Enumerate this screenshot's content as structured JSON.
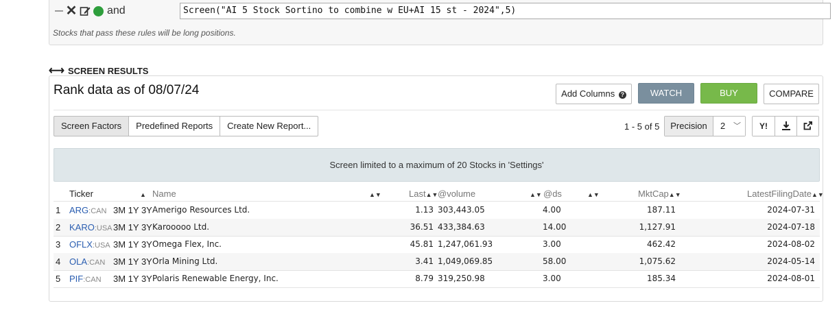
{
  "rule": {
    "connector": "and",
    "formula": "Screen(\"AI 5 Stock Sortino to combine w EU+AI 15 st - 2024\",5)",
    "note": "Stocks that pass these rules will be long positions."
  },
  "section_title": "SCREEN RESULTS",
  "rank_title": "Rank data as of 08/07/24",
  "buttons": {
    "add_columns": "Add Columns",
    "watch": "WATCH",
    "buy": "BUY",
    "compare": "COMPARE"
  },
  "tabs": [
    "Screen Factors",
    "Predefined Reports",
    "Create New Report..."
  ],
  "pagination": "1 - 5 of 5",
  "precision": {
    "label": "Precision",
    "value": "2"
  },
  "tools": {
    "yahoo": "Y!"
  },
  "notice": "Screen limited to a maximum of 20 Stocks in 'Settings'",
  "columns": {
    "ticker": "Ticker",
    "name": "Name",
    "last": "Last",
    "volume": "@volume",
    "ds": "@ds",
    "mktcap": "MktCap",
    "filing": "LatestFilingDate"
  },
  "period_labels": "3M 1Y 3Y",
  "rows": [
    {
      "idx": "1",
      "ticker": "ARG",
      "exchange": ":CAN",
      "name": "Amerigo Resources Ltd.",
      "last": "1.13",
      "volume": "303,443.05",
      "ds": "4.00",
      "mktcap": "187.11",
      "filing": "2024-07-31"
    },
    {
      "idx": "2",
      "ticker": "KARO",
      "exchange": ":USA",
      "name": "Karooooo Ltd.",
      "last": "36.51",
      "volume": "433,384.63",
      "ds": "14.00",
      "mktcap": "1,127.91",
      "filing": "2024-07-18"
    },
    {
      "idx": "3",
      "ticker": "OFLX",
      "exchange": ":USA",
      "name": "Omega Flex, Inc.",
      "last": "45.81",
      "volume": "1,247,061.93",
      "ds": "3.00",
      "mktcap": "462.42",
      "filing": "2024-08-02"
    },
    {
      "idx": "4",
      "ticker": "OLA",
      "exchange": ":CAN",
      "name": "Orla Mining Ltd.",
      "last": "3.41",
      "volume": "1,049,069.85",
      "ds": "58.00",
      "mktcap": "1,075.62",
      "filing": "2024-05-14"
    },
    {
      "idx": "5",
      "ticker": "PIF",
      "exchange": ":CAN",
      "name": "Polaris Renewable Energy, Inc.",
      "last": "8.79",
      "volume": "319,250.98",
      "ds": "3.00",
      "mktcap": "185.34",
      "filing": "2024-08-01"
    }
  ],
  "colors": {
    "watch": "#7a8f9e",
    "buy": "#77b94a",
    "active_dot": "#2e9e3c",
    "ticker_link": "#2a5db0",
    "notice_bg": "#dfe7ea"
  }
}
